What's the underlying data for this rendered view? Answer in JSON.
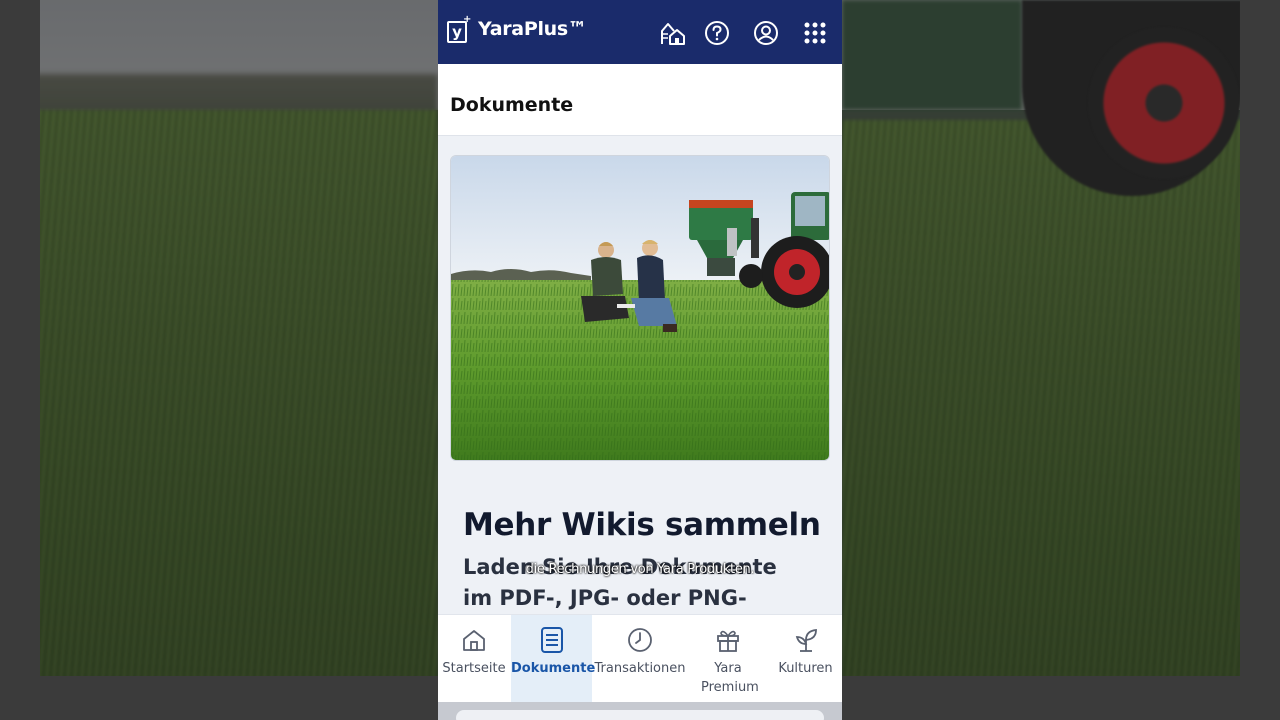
{
  "app": {
    "logo_letter": "y",
    "logo_plus": "+",
    "title": "YaraPlus™"
  },
  "topbar_icons": [
    "farm-house-icon",
    "help-icon",
    "account-icon",
    "apps-grid-icon"
  ],
  "page": {
    "title": "Dokumente"
  },
  "hero": {
    "image_description": "Two farmers kneeling in a grass field next to a green fertilizer spreader and tractor"
  },
  "content": {
    "heading": "Mehr Wikis sammeln",
    "subheading": "Laden Sie Ihre Dokumente im PDF-, JPG- oder PNG-Format"
  },
  "caption": "die Rechnungen von Yara Produkten.",
  "tabs": [
    {
      "label": "Startseite",
      "icon": "home-icon",
      "active": false
    },
    {
      "label": "Dokumente",
      "icon": "document-icon",
      "active": true
    },
    {
      "label": "Transaktionen",
      "icon": "clock-icon",
      "active": false
    },
    {
      "label": "Yara Premium",
      "icon": "gift-icon",
      "active": false
    },
    {
      "label": "Kulturen",
      "icon": "sprout-icon",
      "active": false
    }
  ],
  "colors": {
    "topbar": "#1a2b6b",
    "active_tab": "#1a56a8",
    "active_tab_bg": "#e4eef8"
  }
}
